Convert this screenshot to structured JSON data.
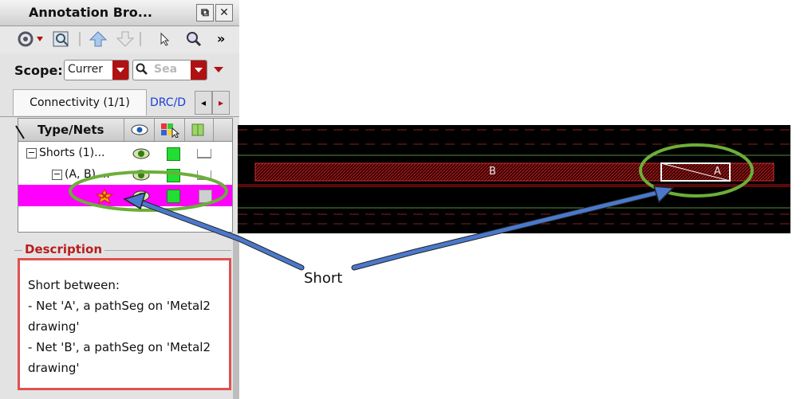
{
  "window": {
    "title": "Annotation Bro...",
    "float_btn": "⧉",
    "close_btn": "✕"
  },
  "toolbar": {
    "more": "»"
  },
  "scope": {
    "label": "Scope:",
    "value": "Currer",
    "search_placeholder": "Sea"
  },
  "tabs": {
    "active": "Connectivity (1/1)",
    "inactive": "DRC/D",
    "prev": "◂",
    "next": "▸"
  },
  "tree": {
    "header": {
      "type_nets": "Type/Nets"
    },
    "rows": [
      {
        "label": "Shorts (1)..."
      },
      {
        "label": "(A, B) ..."
      },
      {
        "label": ""
      }
    ]
  },
  "description": {
    "label": "Description",
    "lines": [
      "Short between:",
      "- Net 'A', a pathSeg on 'Metal2",
      "drawing'",
      "- Net 'B', a pathSeg on 'Metal2",
      "drawing'"
    ]
  },
  "layout": {
    "net_b": "B",
    "net_a": "A"
  },
  "callout": {
    "label": "Short"
  },
  "colors": {
    "highlight": "#ff00ff",
    "annotation_green": "#6cae3a",
    "arrow_blue": "#4a78cc",
    "metal_red": "#b22222"
  }
}
